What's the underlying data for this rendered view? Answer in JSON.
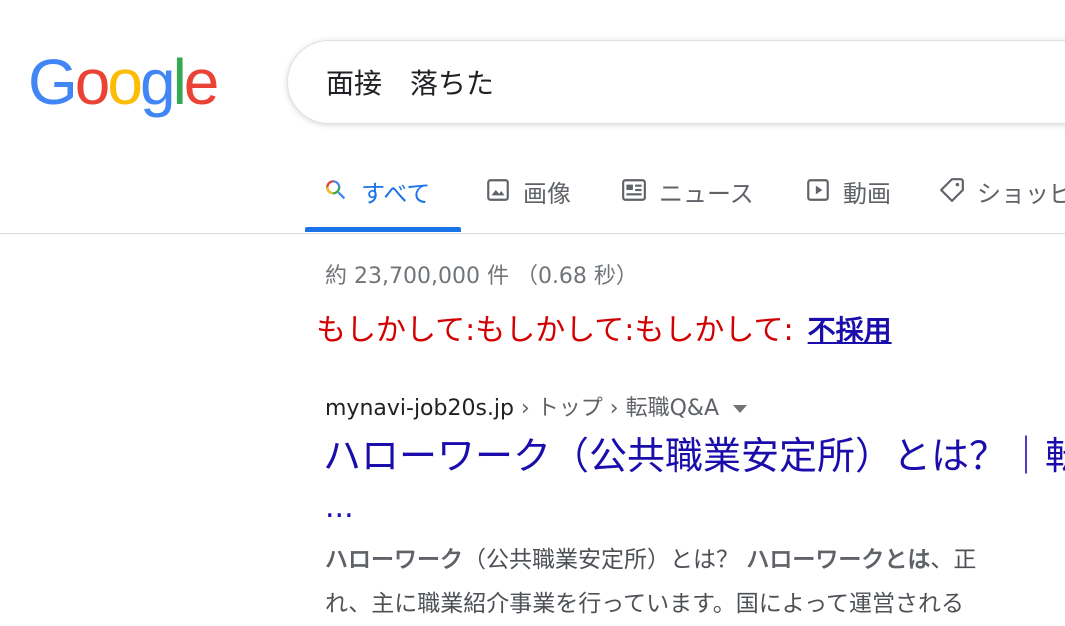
{
  "logo": {
    "letters": [
      "G",
      "o",
      "o",
      "g",
      "l",
      "e"
    ],
    "colors": [
      "#4285F4",
      "#EA4335",
      "#FBBC05",
      "#4285F4",
      "#34A853",
      "#EA4335"
    ]
  },
  "search": {
    "query": "面接　落ちた"
  },
  "tabs": [
    {
      "label": "すべて",
      "icon": "search-icon",
      "active": true
    },
    {
      "label": "画像",
      "icon": "image-icon"
    },
    {
      "label": "ニュース",
      "icon": "news-icon"
    },
    {
      "label": "動画",
      "icon": "play-icon"
    },
    {
      "label": "ショッピ",
      "icon": "tag-icon"
    }
  ],
  "stats": "約 23,700,000 件 （0.68 秒）",
  "didyoumean": {
    "prefix": "もしかして:もしかして:もしかして:",
    "suggestion": "不採用"
  },
  "result": {
    "domain": "mynavi-job20s.jp",
    "path": " › トップ › 転職Q&A",
    "title": "ハローワーク（公共職業安定所）とは？｜転",
    "ellipsis": "...",
    "snippet1_bold": "ハローワーク",
    "snippet1_text": "（公共職業安定所）とは？ ",
    "snippet2_bold": "ハローワークとは",
    "snippet2_text": "、正",
    "snippet_line2": "れ、主に職業紹介事業を行っています。国によって運営される"
  },
  "colors": {
    "accent": "#1a73e8",
    "link": "#1a0dab",
    "didyoumean_red": "#d20000"
  }
}
